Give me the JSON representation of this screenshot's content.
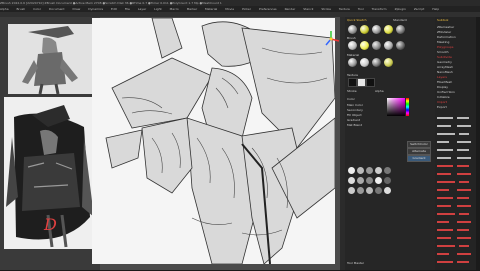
{
  "window": {
    "title": "ZBrush 2022.0.6   [22020710]   ZBrush Document   ●Active Mem 2708 ●Scratch Disk 36 ●RTime 0.7 ●Timer 0.011 ●PolyCount 1.7 Mp ●MeshCount 1"
  },
  "menu": {
    "items": [
      "Alpha",
      "Brush",
      "Color",
      "Document",
      "Draw",
      "Dynamics",
      "Edit",
      "File",
      "Layer",
      "Light",
      "Macro",
      "Marker",
      "Material",
      "Movie",
      "Picker",
      "Preferences",
      "Render",
      "Stencil",
      "Stroke",
      "Texture",
      "Tool",
      "Transform",
      "Zplugin",
      "Zscript",
      "Help"
    ]
  },
  "reference": {
    "signature": "D"
  },
  "palette": {
    "header_left": "Quick Sketch",
    "header_right": "Standard",
    "brushes_label": "Brush",
    "material_label": "Material",
    "color_label": "Color",
    "gradient_label": "Gradient",
    "switch_color": "SwitchColor",
    "alternate": "Alternate",
    "texture_label": "Texture",
    "stroke_label": "Stroke",
    "alpha_label": "Alpha",
    "settings": [
      "Main Color",
      "Secondary",
      "Fill Object",
      "Gradient",
      "Mat Blend"
    ],
    "footer_label": "Tool Master"
  },
  "props": {
    "header": "Subtool",
    "items": [
      "ZRemesher",
      "ZModeler",
      "Deformation",
      "Masking",
      "Polygroups",
      "Smooth",
      "Subdivide",
      "Geometry",
      "ArrayMesh",
      "NanoMesh",
      "Layers",
      "FiberMesh",
      "Display",
      "Unified Skin",
      "Initialize",
      "Import",
      "Export"
    ],
    "highlighted": [
      "Polygroups",
      "Subdivide",
      "Layers",
      "Import"
    ]
  }
}
